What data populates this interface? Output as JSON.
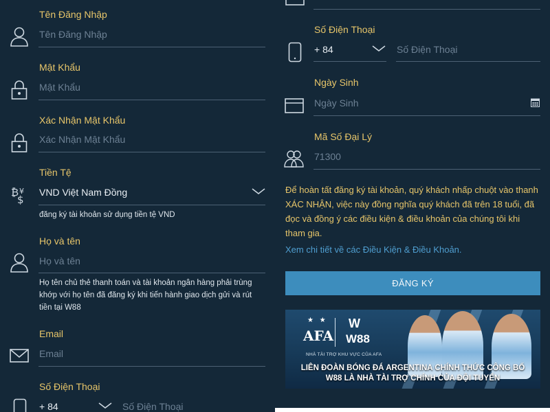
{
  "left": {
    "username": {
      "label": "Tên Đăng Nhập",
      "placeholder": "Tên Đăng Nhập",
      "icon": "user-icon"
    },
    "password": {
      "label": "Mật Khẩu",
      "placeholder": "Mật Khẩu",
      "icon": "lock-icon"
    },
    "confirm_password": {
      "label": "Xác Nhận Mật Khẩu",
      "placeholder": "Xác Nhận Mật Khẩu",
      "icon": "lock-icon"
    },
    "currency": {
      "label": "Tiền Tệ",
      "value": "VND Việt Nam Đồng",
      "help": "đăng ký tài khoản sử dụng tiền tệ VND",
      "icon": "currency-exchange-icon"
    },
    "fullname": {
      "label": "Họ và tên",
      "placeholder": "Họ và tên",
      "help": "Họ tên chủ thẻ thanh toán và tài khoản ngân hàng phải trùng khớp với họ tên đã đăng ký khi tiến hành giao dịch gửi và rút tiền tại W88",
      "icon": "user-icon"
    },
    "email": {
      "label": "Email",
      "placeholder": "Email",
      "icon": "envelope-icon"
    },
    "phone": {
      "label": "Số Điện Thoại",
      "code": "+ 84",
      "placeholder": "Số Điện Thoại",
      "icon": "mobile-phone-icon"
    }
  },
  "right": {
    "phone": {
      "label": "Số Điện Thoại",
      "code": "+ 84",
      "placeholder": "Số Điện Thoại",
      "icon": "mobile-phone-icon"
    },
    "birthday": {
      "label": "Ngày Sinh",
      "placeholder": "Ngày Sinh",
      "icon": "calendar-icon"
    },
    "agent": {
      "label": "Mã Số Đại Lý",
      "value": "71300",
      "icon": "users-icon"
    },
    "terms_text": "Để hoàn tất đăng ký tài khoản, quý khách nhấp chuột vào thanh XÁC NHẬN, việc này đồng nghĩa quý khách đã trên 18 tuổi, đã đọc và đồng ý các điều kiện & điều khoản của chúng tôi khi tham gia.",
    "terms_link": "Xem chi tiết về các Điều Kiện & Điều Khoản.",
    "register_button": "ĐĂNG KÝ",
    "banner": {
      "stars": "★ ★",
      "afa": "AFA",
      "w_logo": "W",
      "w88": "W88",
      "sponsor_text": "NHÀ TÀI TRỢ KHU VỰC CỦA AFA",
      "headline_1": "LIÊN ĐOÀN BÓNG ĐÁ ARGENTINA CHÍNH THỨC CÔNG BỐ",
      "headline_2": "W88 LÀ NHÀ TÀI TRỢ CHÍNH CỦA ĐỘI TUYỂN"
    }
  },
  "colors": {
    "background": "#142838",
    "label": "#e8c66a",
    "button": "#3d8dbd",
    "link": "#4f9ed0"
  }
}
